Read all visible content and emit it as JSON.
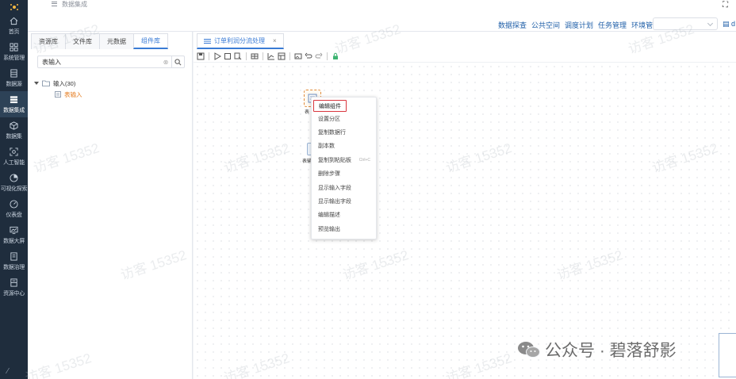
{
  "nav": {
    "items": [
      {
        "label": "首页",
        "icon": "home-icon"
      },
      {
        "label": "系统管理",
        "icon": "grid-icon"
      },
      {
        "label": "数据源",
        "icon": "database-icon"
      },
      {
        "label": "数据集成",
        "icon": "layers-icon",
        "active": true
      },
      {
        "label": "数据集",
        "icon": "cube-icon"
      },
      {
        "label": "人工智能",
        "icon": "ai-icon"
      },
      {
        "label": "可视化探索",
        "icon": "pie-icon"
      },
      {
        "label": "仪表盘",
        "icon": "gauge-icon"
      },
      {
        "label": "数据大屏",
        "icon": "screen-icon"
      },
      {
        "label": "数据治理",
        "icon": "book-icon"
      },
      {
        "label": "资源中心",
        "icon": "folder-icon"
      }
    ]
  },
  "header": {
    "breadcrumb": "数据集成",
    "menu": [
      "数据探查",
      "公共空间",
      "调度计划",
      "任务管理",
      "环境管理"
    ],
    "select_value": "",
    "right_link": "d"
  },
  "panel": {
    "tabs": [
      {
        "label": "资源库",
        "active": false
      },
      {
        "label": "文件库",
        "active": false
      },
      {
        "label": "元数据",
        "active": false
      },
      {
        "label": "组件库",
        "active": true
      }
    ],
    "search_value": "表输入",
    "tree": {
      "parent": "输入(30)",
      "child": "表输入"
    }
  },
  "work": {
    "tab_label": "订单利润分流处理",
    "node1_label": "表",
    "node2_label": "表输"
  },
  "context_menu": {
    "items": [
      {
        "label": "编辑组件",
        "highlight": true
      },
      {
        "label": "设置分区"
      },
      {
        "label": "复制数据行"
      },
      {
        "label": "副本数"
      },
      {
        "label": "复制到粘贴板",
        "shortcut": "Ctrl+C"
      },
      {
        "label": "删除步骤"
      },
      {
        "label": "显示输入字段"
      },
      {
        "label": "显示输出字段"
      },
      {
        "label": "编辑描述"
      },
      {
        "label": "预览输出"
      }
    ]
  },
  "watermark": "访客 15352",
  "brand": "公众号 · 碧落舒影",
  "colors": {
    "nav_bg": "#1f2d3d",
    "accent": "#3a7bd5",
    "highlight_border": "#d9363e"
  }
}
